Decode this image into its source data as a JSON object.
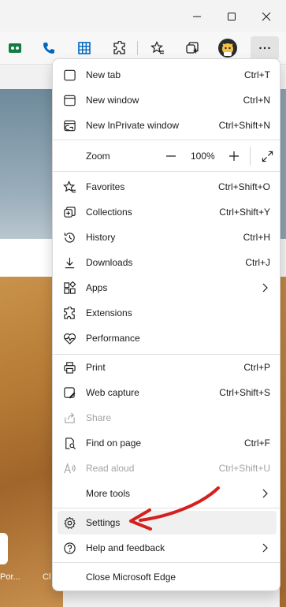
{
  "window_controls": [
    "minimize",
    "maximize",
    "close"
  ],
  "toolbar": {
    "icons": [
      "meeting-icon",
      "phone-icon",
      "grid-icon",
      "extensions-icon",
      "favorites-icon",
      "collections-icon",
      "profile-avatar",
      "more-icon"
    ]
  },
  "background": {
    "tile_labels": [
      "Por...",
      "Cl"
    ]
  },
  "menu": {
    "items": [
      {
        "label": "New tab",
        "shortcut": "Ctrl+T"
      },
      {
        "label": "New window",
        "shortcut": "Ctrl+N"
      },
      {
        "label": "New InPrivate window",
        "shortcut": "Ctrl+Shift+N"
      },
      {
        "label": "Zoom",
        "zoom_value": "100%"
      },
      {
        "label": "Favorites",
        "shortcut": "Ctrl+Shift+O"
      },
      {
        "label": "Collections",
        "shortcut": "Ctrl+Shift+Y"
      },
      {
        "label": "History",
        "shortcut": "Ctrl+H"
      },
      {
        "label": "Downloads",
        "shortcut": "Ctrl+J"
      },
      {
        "label": "Apps"
      },
      {
        "label": "Extensions"
      },
      {
        "label": "Performance"
      },
      {
        "label": "Print",
        "shortcut": "Ctrl+P"
      },
      {
        "label": "Web capture",
        "shortcut": "Ctrl+Shift+S"
      },
      {
        "label": "Share"
      },
      {
        "label": "Find on page",
        "shortcut": "Ctrl+F"
      },
      {
        "label": "Read aloud",
        "shortcut": "Ctrl+Shift+U"
      },
      {
        "label": "More tools"
      },
      {
        "label": "Settings"
      },
      {
        "label": "Help and feedback"
      },
      {
        "label": "Close Microsoft Edge"
      }
    ]
  },
  "colors": {
    "annotation_arrow": "#d42020",
    "toolbar_blue": "#0067c0",
    "meeting_green": "#107c41"
  }
}
